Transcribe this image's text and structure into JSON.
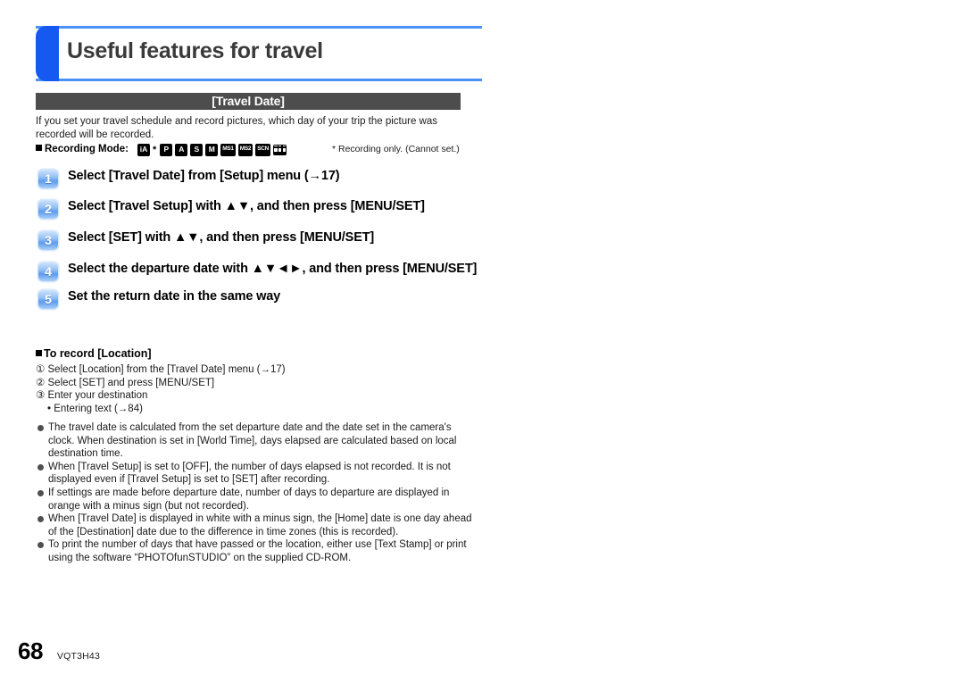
{
  "chapter": {
    "title": "Useful features for travel",
    "accent_color": "#1659f0",
    "border_color": "#4a90f5"
  },
  "section": {
    "bar_label": "[Travel Date]",
    "bar_color": "#4d4d4d",
    "intro": "If you set your travel schedule and record pictures, which day of your trip the picture was recorded will be recorded."
  },
  "recording_mode": {
    "label": "Recording Mode:",
    "note": "* Recording only. (Cannot set.)",
    "icons": [
      {
        "name": "mode-icon-ia",
        "glyph": "iA",
        "style": "inv"
      },
      {
        "name": "mode-icon-p",
        "glyph": "P",
        "style": "inv"
      },
      {
        "name": "mode-icon-a",
        "glyph": "A",
        "style": "inv"
      },
      {
        "name": "mode-icon-s",
        "glyph": "S",
        "style": "inv"
      },
      {
        "name": "mode-icon-m",
        "glyph": "M",
        "style": "inv"
      },
      {
        "name": "mode-icon-ms1",
        "glyph": "MS1",
        "style": "inv tiny"
      },
      {
        "name": "mode-icon-ms2",
        "glyph": "MS2",
        "style": "inv tiny"
      },
      {
        "name": "mode-icon-scn",
        "glyph": "SCN",
        "style": "inv tiny"
      },
      {
        "name": "mode-icon-movie",
        "glyph": "",
        "style": "film"
      }
    ]
  },
  "steps": [
    {
      "num": "1",
      "text": "Select [Travel Date] from [Setup] menu (→17)"
    },
    {
      "num": "2",
      "text": "Select [Travel Setup] with ▲▼, and then press [MENU/SET]"
    },
    {
      "num": "3",
      "text": "Select [SET] with ▲▼, and then press [MENU/SET]"
    },
    {
      "num": "4",
      "text": "Select the departure date with ▲▼◄►, and then press [MENU/SET]"
    },
    {
      "num": "5",
      "text": "Set the return date in the same way"
    }
  ],
  "subsection": {
    "title": "To record [Location]",
    "items": [
      "① Select [Location] from the [Travel Date] menu (→17)",
      "② Select [SET] and press [MENU/SET]",
      "③ Enter your destination"
    ],
    "subbullet": "• Entering text (→84)"
  },
  "notes": [
    "The travel date is calculated from the set departure date and the date set in the camera's clock. When destination is set in [World Time], days elapsed are calculated based on local destination time.",
    "When [Travel Setup] is set to [OFF], the number of days elapsed is not recorded. It is not displayed even if [Travel Setup] is set to [SET] after recording.",
    "If settings are made before departure date, number of days to departure are displayed in orange with a minus sign (but not recorded).",
    "When [Travel Date] is displayed in white with a minus sign, the [Home] date is one day ahead of the [Destination] date due to the difference in time zones (this is recorded).",
    "To print the number of days that have passed or the location, either use [Text Stamp] or print using the software “PHOTOfunSTUDIO” on the supplied CD-ROM."
  ],
  "footer": {
    "page_number": "68",
    "doc_code": "VQT3H43"
  }
}
